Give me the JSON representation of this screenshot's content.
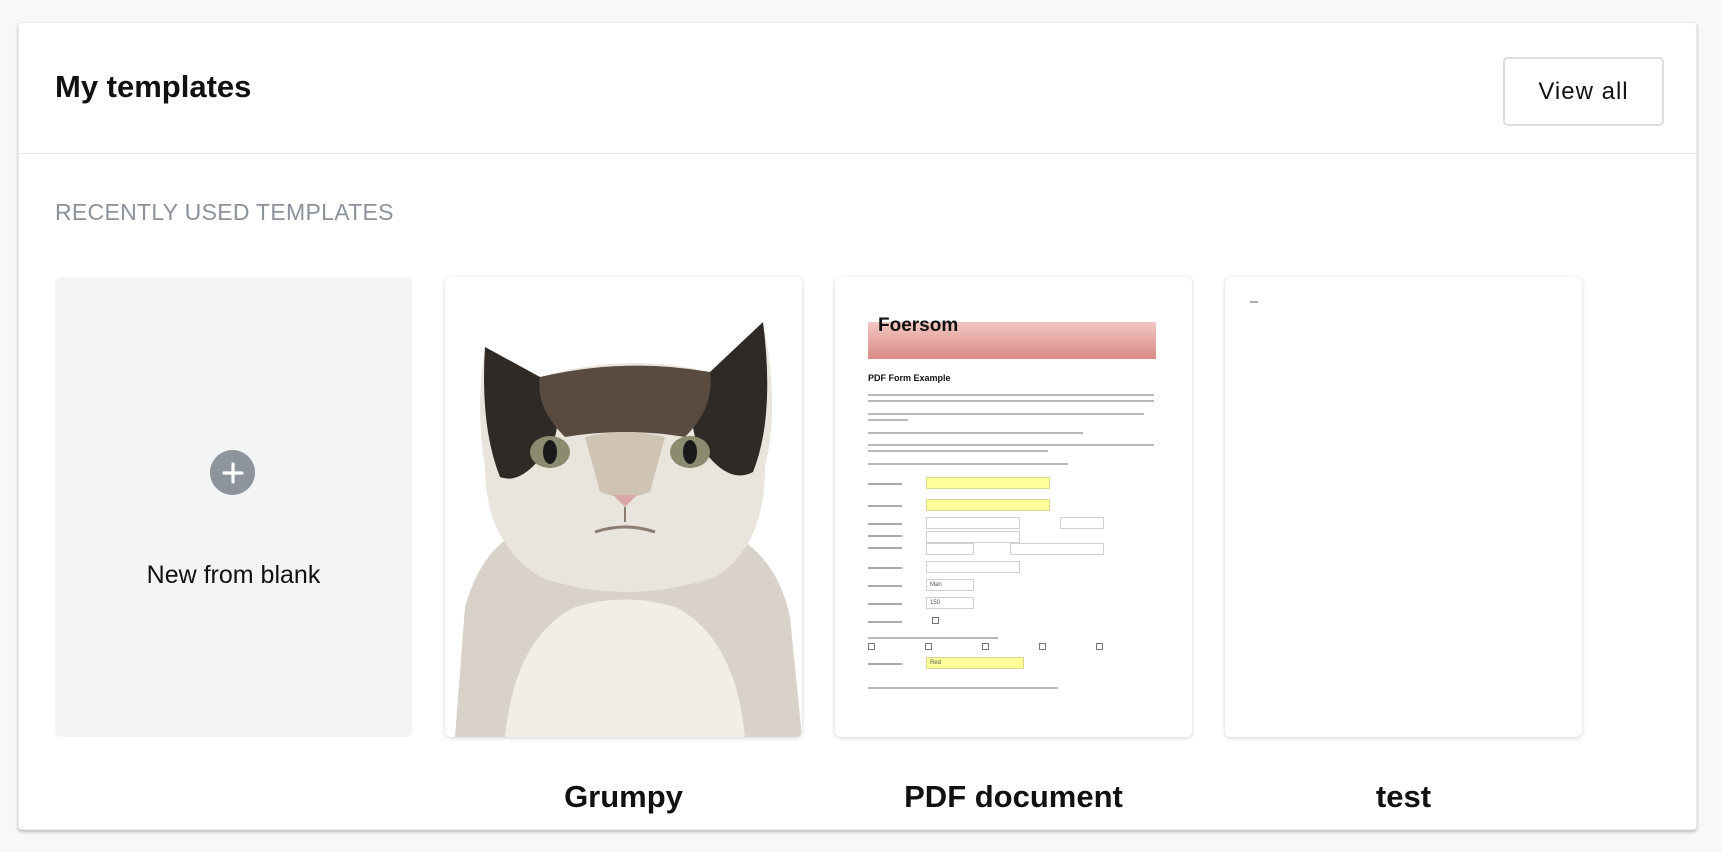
{
  "header": {
    "title": "My templates",
    "view_all_label": "View all"
  },
  "section": {
    "label": "RECENTLY USED TEMPLATES"
  },
  "new_blank": {
    "label": "New from blank",
    "icon": "plus-icon"
  },
  "templates": [
    {
      "name": "Grumpy",
      "thumbnail": "grumpy-cat-photo"
    },
    {
      "name": "PDF document",
      "thumbnail": "pdf-form-example"
    },
    {
      "name": "test",
      "thumbnail": "blank-page"
    }
  ],
  "pdf_thumb": {
    "logo": "Foersom",
    "heading": "PDF Form Example",
    "field_values": [
      "Man",
      "150",
      "Red"
    ]
  },
  "colors": {
    "page_bg": "#f8f8f9",
    "card_bg": "#ffffff",
    "section_label": "#8b929b",
    "blank_tile": "#f3f4f6",
    "plus_circle": "#8d949c",
    "pdf_highlight": "#ffff99"
  }
}
